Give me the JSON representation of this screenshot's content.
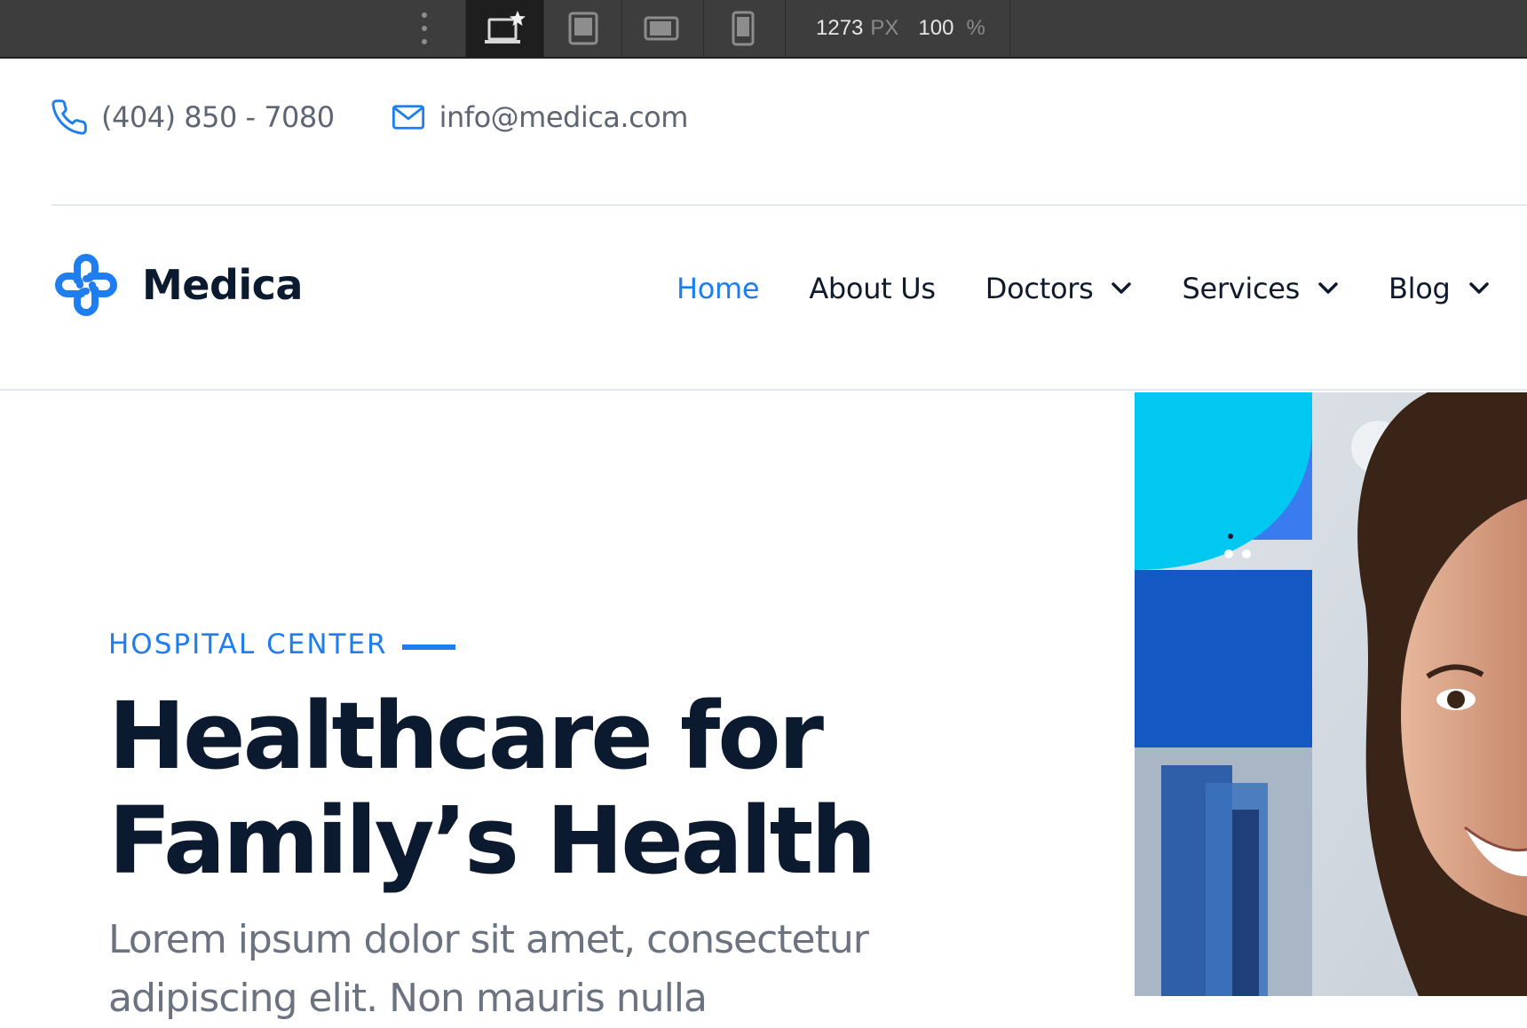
{
  "toolbar": {
    "width_value": "1273",
    "width_unit": "PX",
    "zoom_value": "100",
    "zoom_unit": "%",
    "devices": [
      "desktop-icon",
      "tablet-icon",
      "tablet-landscape-icon",
      "mobile-icon"
    ],
    "active_device": "desktop"
  },
  "contact": {
    "phone": "(404) 850 - 7080",
    "email": "info@medica.com"
  },
  "brand": {
    "name": "Medica",
    "accent_color": "#1e7ef0",
    "dark_color": "#0b1a2e"
  },
  "nav": {
    "items": [
      {
        "label": "Home",
        "active": true
      },
      {
        "label": "About Us"
      },
      {
        "label": "Doctors",
        "dropdown": true
      },
      {
        "label": "Services",
        "dropdown": true
      },
      {
        "label": "Blog",
        "dropdown": true
      }
    ]
  },
  "hero": {
    "eyebrow": "HOSPITAL CENTER",
    "title_line1": "Healthcare for",
    "title_line2": "Family’s Health",
    "description": "Lorem ipsum dolor sit amet, consectetur adipiscing elit. Non mauris nulla"
  }
}
